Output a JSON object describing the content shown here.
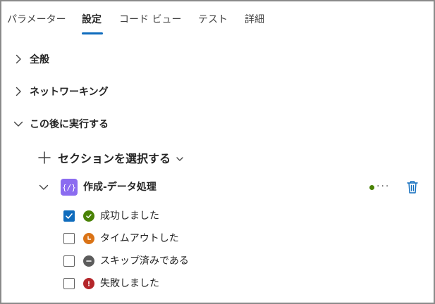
{
  "tabs": [
    {
      "label": "パラメーター"
    },
    {
      "label": "設定"
    },
    {
      "label": "コード ビュー"
    },
    {
      "label": "テスト"
    },
    {
      "label": "詳細"
    }
  ],
  "active_tab": "設定",
  "sections": {
    "general": "全般",
    "networking": "ネットワーキング",
    "run_after": "この後に実行する"
  },
  "run_after": {
    "select_label": "セクションを選択する",
    "action": {
      "icon_text": "{/}",
      "name": "作成-データ処理",
      "status_dot_color": "#498205"
    },
    "statuses": [
      {
        "label": "成功しました",
        "checked": true,
        "icon": "success-check-icon",
        "color": "#498205"
      },
      {
        "label": "タイムアウトした",
        "checked": false,
        "icon": "clock-icon",
        "color": "#da7316"
      },
      {
        "label": "スキップ済みである",
        "checked": false,
        "icon": "skip-minus-icon",
        "color": "#5c5c5c"
      },
      {
        "label": "失敗しました",
        "checked": false,
        "icon": "error-exclamation-icon",
        "color": "#b4262a"
      }
    ]
  }
}
